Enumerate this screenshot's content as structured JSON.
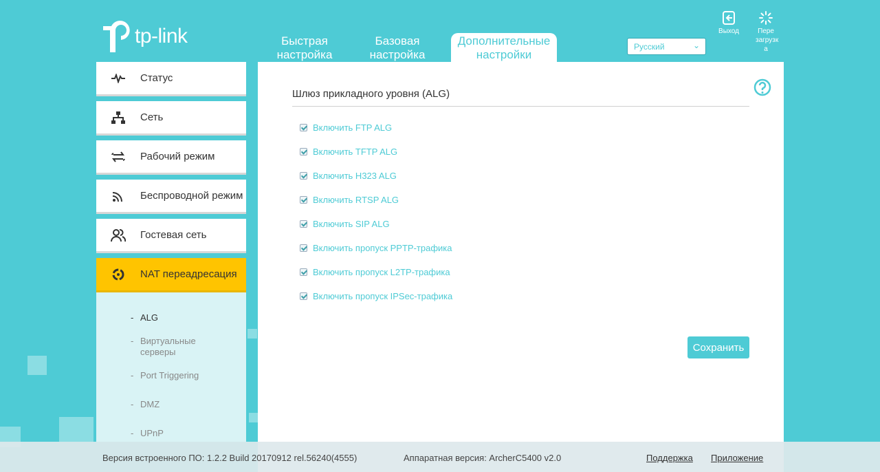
{
  "brand": {
    "logo_text": "tp-link"
  },
  "topnav": {
    "tabs": [
      {
        "label": "Быстрая настройка"
      },
      {
        "label": "Базовая настройка"
      },
      {
        "label": "Дополнительные настройки"
      }
    ]
  },
  "language": {
    "selected": "Русский"
  },
  "top_actions": {
    "logout": "Выход",
    "reboot": "Пере загрузк а"
  },
  "sidebar": {
    "items": [
      {
        "label": "Статус"
      },
      {
        "label": "Сеть"
      },
      {
        "label": "Рабочий режим"
      },
      {
        "label": "Беспроводной режим"
      },
      {
        "label": "Гостевая сеть"
      },
      {
        "label": "NAT переадресация"
      }
    ],
    "submenu": [
      {
        "label": "ALG"
      },
      {
        "label": "Виртуальные серверы"
      },
      {
        "label": "Port Triggering"
      },
      {
        "label": "DMZ"
      },
      {
        "label": "UPnP"
      }
    ],
    "dash": "-"
  },
  "main": {
    "section_title": "Шлюз прикладного уровня (ALG)",
    "options": [
      {
        "label": "Включить FTP ALG",
        "checked": true
      },
      {
        "label": "Включить TFTP ALG",
        "checked": true
      },
      {
        "label": "Включить H323 ALG",
        "checked": true
      },
      {
        "label": "Включить RTSP ALG",
        "checked": true
      },
      {
        "label": "Включить SIP ALG",
        "checked": true
      },
      {
        "label": "Включить пропуск PPTP-трафика",
        "checked": true
      },
      {
        "label": "Включить пропуск L2TP-трафика",
        "checked": true
      },
      {
        "label": "Включить пропуск IPSec-трафика",
        "checked": true
      }
    ],
    "save_label": "Сохранить"
  },
  "footer": {
    "firmware": "Версия встроенного ПО: 1.2.2 Build 20170912 rel.56240(4555)",
    "hardware": "Аппаратная версия: ArcherC5400 v2.0",
    "support": "Поддержка",
    "app": "Приложение"
  },
  "colors": {
    "accent": "#4ecbd5",
    "active": "#ffc400"
  }
}
